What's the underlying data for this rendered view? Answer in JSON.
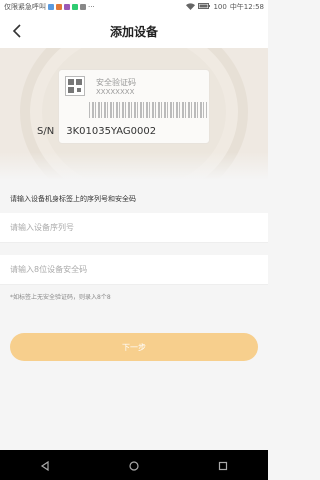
{
  "status_bar": {
    "carrier_text": "仅限紧急呼叫",
    "battery_percent": "100",
    "time": "中午12:58"
  },
  "header": {
    "title": "添加设备",
    "back_icon": "chevron-left-icon"
  },
  "device_label": {
    "security_label": "安全验证码",
    "security_code_mask": "XXXXXXXX",
    "sn_prefix": "S/N",
    "serial_number": "3K01035YAG0002"
  },
  "form": {
    "instruction": "请输入设备机身标签上的序列号和安全码",
    "serial_input": {
      "value": "",
      "placeholder": "请输入设备序列号"
    },
    "security_input": {
      "value": "",
      "placeholder": "请输入8位设备安全码"
    },
    "hint": "*如标签上无安全验证码，则录入8个8"
  },
  "actions": {
    "next_label": "下一步"
  },
  "colors": {
    "accent": "#f7cf8d",
    "background": "#f5f5f5",
    "nav_bar": "#000000"
  }
}
